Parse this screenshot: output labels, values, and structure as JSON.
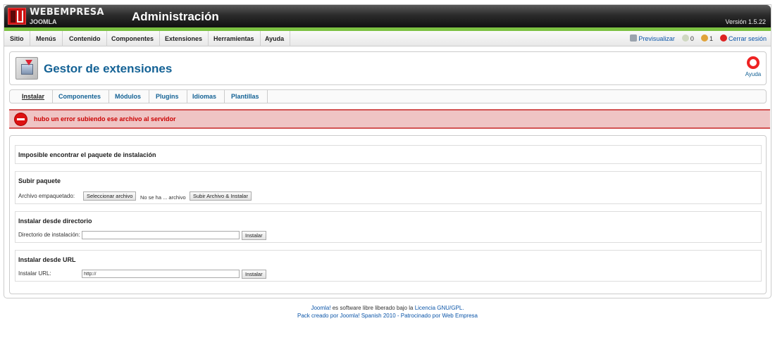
{
  "topbar": {
    "brand": "WEBEMPRESA",
    "brand_sub": "JOOMLA",
    "title": "Administración",
    "version": "Versión 1.5.22"
  },
  "menu": [
    "Sitio",
    "Menús",
    "Contenido",
    "Componentes",
    "Extensiones",
    "Herramientas",
    "Ayuda"
  ],
  "status": {
    "preview_label": "Previsualizar",
    "messages_count": "0",
    "users_count": "1",
    "logout_label": "Cerrar sesión"
  },
  "header": {
    "title": "Gestor de extensiones",
    "help_label": "Ayuda"
  },
  "submenu": {
    "items": [
      "Instalar",
      "Componentes",
      "Módulos",
      "Plugins",
      "Idiomas",
      "Plantillas"
    ],
    "active": "Instalar"
  },
  "error": {
    "message": "hubo un error subiendo ese archivo al servidor"
  },
  "sections": {
    "notice": {
      "title": "Imposible encontrar el paquete de instalación"
    },
    "upload": {
      "title": "Subir paquete",
      "label": "Archivo empaquetado:",
      "file_button": "Seleccionar archivo",
      "file_status": "No se ha ... archivo",
      "submit_label": "Subir Archivo & Instalar"
    },
    "directory": {
      "title": "Instalar desde directorio",
      "label": "Directorio de instalación:",
      "value": "",
      "submit_label": "Instalar"
    },
    "url": {
      "title": "Instalar desde URL",
      "label": "Instalar URL:",
      "value": "http://",
      "submit_label": "Instalar"
    }
  },
  "footer": {
    "line1_joomla": "Joomla!",
    "line1_text": " es software libre liberado bajo la ",
    "line1_license": "Licencia GNU/GPL",
    "line1_end": ".",
    "line2_pack": "Pack creado por Joomla! Spanish 2010",
    "line2_sep": " - ",
    "line2_sponsor": "Patrocinado por Web Empresa"
  },
  "colors": {
    "accent_green": "#7cc142",
    "title_blue": "#146295",
    "error_red": "#cc0000",
    "error_bg": "#efc4c4"
  }
}
